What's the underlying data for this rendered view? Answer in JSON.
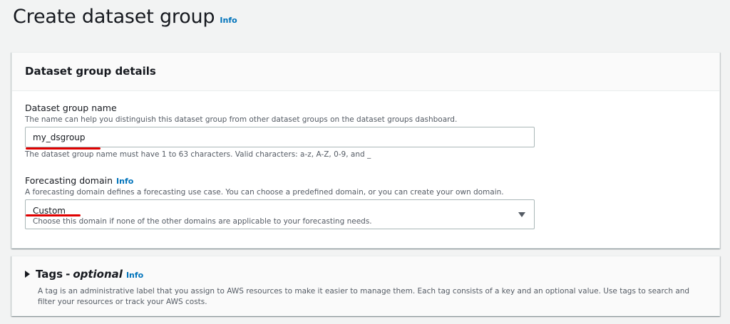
{
  "page": {
    "title": "Create dataset group",
    "info_label": "Info"
  },
  "details_panel": {
    "title": "Dataset group details",
    "name_field": {
      "label": "Dataset group name",
      "description": "The name can help you distinguish this dataset group from other dataset groups on the dataset groups dashboard.",
      "value": "my_dsgroup",
      "constraint": "The dataset group name must have 1 to 63 characters. Valid characters: a-z, A-Z, 0-9, and _"
    },
    "domain_field": {
      "label": "Forecasting domain",
      "info_label": "Info",
      "description": "A forecasting domain defines a forecasting use case. You can choose a predefined domain, or you can create your own domain.",
      "selected_value": "Custom",
      "selected_description": "Choose this domain if none of the other domains are applicable to your forecasting needs."
    }
  },
  "tags_panel": {
    "title": "Tags",
    "separator": "-",
    "optional_label": "optional",
    "info_label": "Info",
    "description": "A tag is an administrative label that you assign to AWS resources to make it easier to manage them. Each tag consists of a key and an optional value. Use tags to search and filter your resources or track your AWS costs."
  },
  "annotations": {
    "underline_color": "#e00000"
  }
}
